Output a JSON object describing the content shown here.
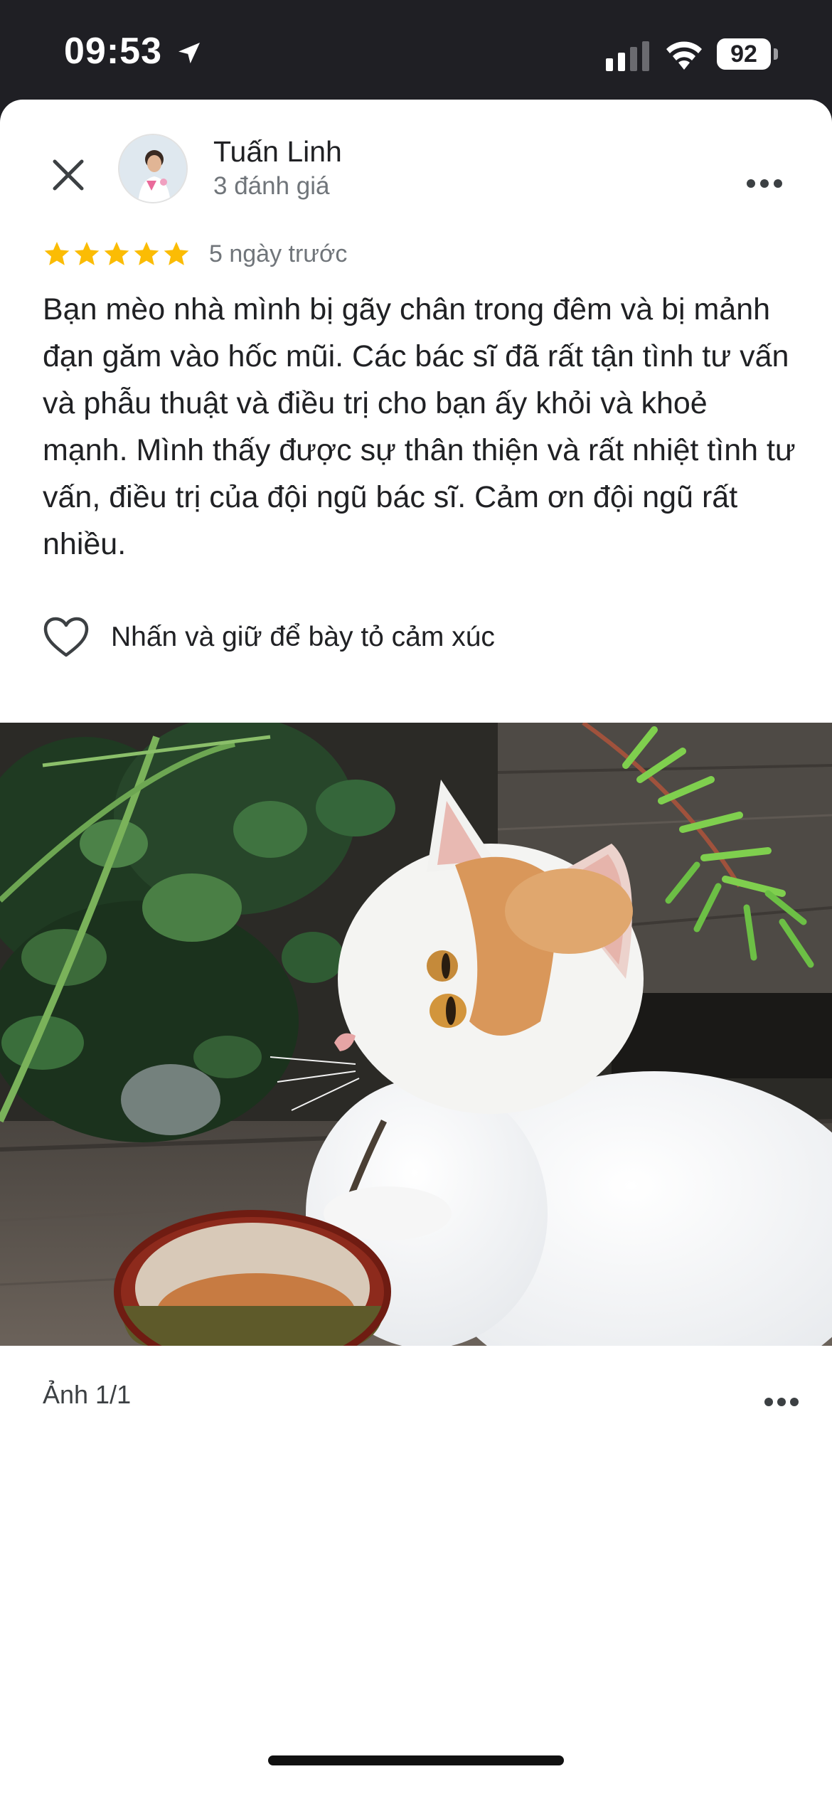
{
  "status_bar": {
    "time": "09:53",
    "battery": "92"
  },
  "review": {
    "reviewer_name": "Tuấn Linh",
    "review_count": "3 đánh giá",
    "rating": 5,
    "date": "5 ngày trước",
    "text": "Bạn mèo nhà mình bị gãy chân trong đêm và bị mảnh đạn găm vào hốc mũi. Các bác sĩ đã rất tận tình tư vấn và phẫu thuật và điều trị cho bạn ấy khỏi và khoẻ mạnh. Mình thấy được sự thân thiện và rất nhiệt tình tư vấn, điều trị của đội ngũ bác sĩ. Cảm ơn đội ngũ rất nhiều.",
    "react_label": "Nhấn và giữ để bày tỏ cảm xúc"
  },
  "photo": {
    "counter": "Ảnh 1/1"
  },
  "icons": {
    "close": "close-icon",
    "more": "more-horizontal-icon",
    "heart": "heart-outline-icon",
    "star": "star-icon",
    "location": "location-arrow-icon",
    "signal": "cellular-signal-icon",
    "wifi": "wifi-icon"
  },
  "colors": {
    "star": "#fbbc04",
    "status_bar_bg": "#1f1f24",
    "text_primary": "#202124",
    "text_secondary": "#70757a"
  }
}
